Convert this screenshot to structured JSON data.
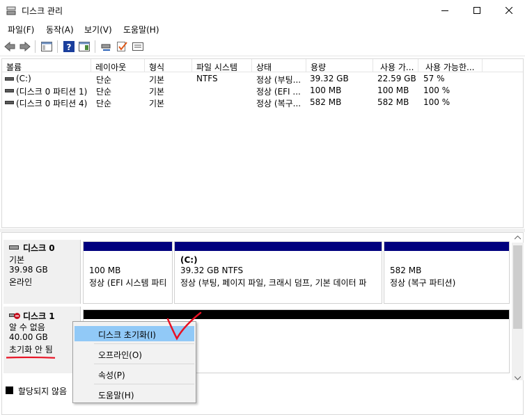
{
  "window": {
    "title": "디스크 관리",
    "controls": {
      "minimize": "minimize-icon",
      "maximize": "maximize-icon",
      "close": "close-icon"
    }
  },
  "menu": [
    "파일(F)",
    "동작(A)",
    "보기(V)",
    "도움말(H)"
  ],
  "toolbar": {
    "buttons": [
      "back-icon",
      "forward-icon",
      "console-tree-icon",
      "help-icon",
      "action-pane-icon",
      "connect-icon",
      "check-icon",
      "properties-icon"
    ]
  },
  "volume_list": {
    "columns": [
      "볼륨",
      "레이아웃",
      "형식",
      "파일 시스템",
      "상태",
      "용량",
      "사용 가...",
      "사용 가능한..."
    ],
    "rows": [
      [
        "(C:)",
        "단순",
        "기본",
        "NTFS",
        "정상 (부팅...",
        "39.32 GB",
        "22.59 GB",
        "57 %"
      ],
      [
        "(디스크 0 파티션 1)",
        "단순",
        "기본",
        "",
        "정상 (EFI ...",
        "100 MB",
        "100 MB",
        "100 %"
      ],
      [
        "(디스크 0 파티션 4)",
        "단순",
        "기본",
        "",
        "정상 (복구...",
        "582 MB",
        "582 MB",
        "100 %"
      ]
    ]
  },
  "disks": [
    {
      "name": "디스크 0",
      "type": "기본",
      "size": "39.98 GB",
      "status": "온라인",
      "partitions": [
        {
          "size": "100 MB",
          "status": "정상 (EFI 시스템 파티",
          "bar_color": "#00007e"
        },
        {
          "name": "(C:)",
          "size": "39.32 GB NTFS",
          "status": "정상 (부팅, 페이지 파일, 크래시 덤프, 기본 데이터 파",
          "bar_color": "#00007e"
        },
        {
          "size": "582 MB",
          "status": "정상 (복구 파티션)",
          "bar_color": "#00007e"
        }
      ]
    },
    {
      "name": "디스크 1",
      "type": "알 수 없음",
      "size": "40.00 GB",
      "status": "초기화 안 됨",
      "bar_color": "#000000"
    }
  ],
  "legend": {
    "label": "할당되지 않음",
    "color": "#000000"
  },
  "context_menu": {
    "items": [
      "디스크 초기화(I)",
      "오프라인(O)",
      "속성(P)",
      "도움말(H)"
    ],
    "highlighted": "디스크 초기화(I)"
  },
  "colors": {
    "primary_partition": "#00007e",
    "unallocated": "#000000",
    "annotation": "#e81123",
    "menu_highlight": "#91c9f7"
  }
}
